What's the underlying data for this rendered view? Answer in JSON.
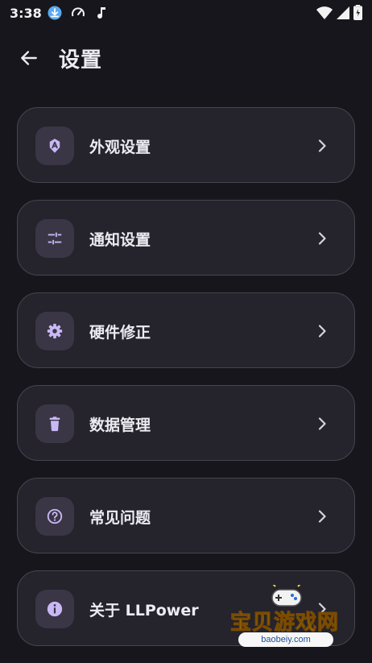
{
  "status_bar": {
    "time": "3:38",
    "icons": [
      "download-icon",
      "speedometer-icon",
      "music-note-icon"
    ],
    "right_icons": [
      "wifi-icon",
      "cellular-signal-icon",
      "battery-charging-icon"
    ]
  },
  "header": {
    "title": "设置",
    "back_icon": "arrow-left-icon"
  },
  "menu": {
    "items": [
      {
        "label": "外观设置",
        "icon": "palette-a-icon"
      },
      {
        "label": "通知设置",
        "icon": "tune-sliders-icon"
      },
      {
        "label": "硬件修正",
        "icon": "gear-icon"
      },
      {
        "label": "数据管理",
        "icon": "trash-icon"
      },
      {
        "label": "常见问题",
        "icon": "help-circle-icon"
      },
      {
        "label": "关于 LLPower",
        "icon": "info-icon"
      }
    ]
  },
  "watermark": {
    "text": "宝贝游戏网",
    "url": "baobeiy.com"
  },
  "colors": {
    "background": "#17161c",
    "card": "#25232b",
    "card_border": "#47444f",
    "icon_box": "#3a3645",
    "accent": "#c9b8f5"
  }
}
